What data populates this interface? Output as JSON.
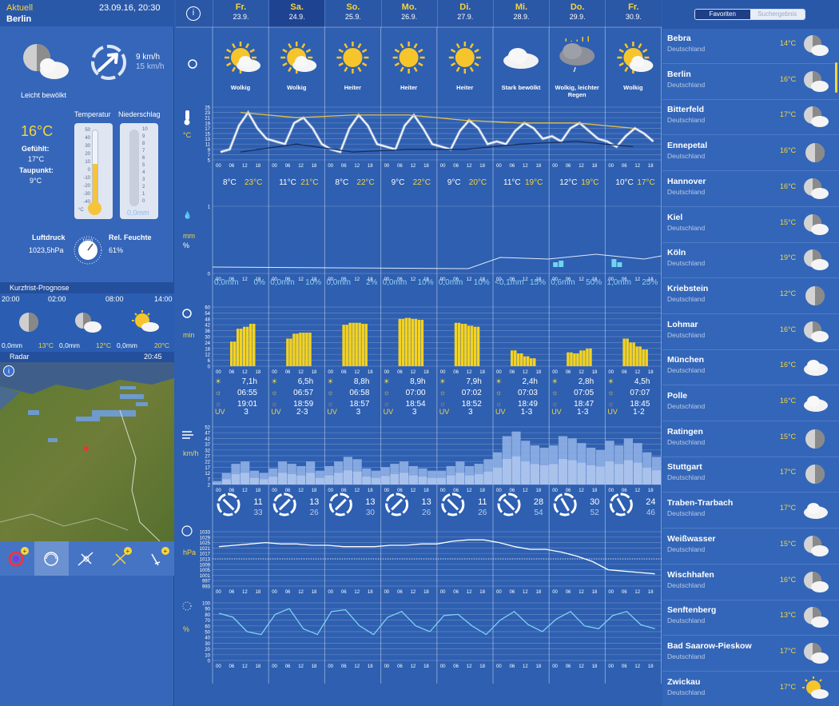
{
  "current": {
    "label": "Aktuell",
    "datetime": "23.09.16, 20:30",
    "city": "Berlin",
    "condition": "Leicht bewölkt",
    "wind_speed_kmh": "9 km/h",
    "wind_gust_kmh": "15 km/h",
    "temp_label": "Temperatur",
    "precip_label": "Niederschlag",
    "temperature": "16°C",
    "feels_label": "Gefühlt:",
    "feels": "17°C",
    "dew_label": "Taupunkt:",
    "dew": "9°C",
    "precip": "0,0mm",
    "pressure_label": "Luftdruck",
    "pressure": "1023,5hPa",
    "humidity_label": "Rel. Feuchte",
    "humidity": "61%",
    "thermo_scale": [
      "50",
      "40",
      "30",
      "20",
      "10",
      "0",
      "-10",
      "-20",
      "-30",
      "-40"
    ],
    "thermo_unit": "°C",
    "precip_scale": [
      "10",
      "9",
      "8",
      "7",
      "6",
      "5",
      "4",
      "3",
      "2",
      "1",
      "0"
    ],
    "baro_value": "1010",
    "thermo_level": 0.56
  },
  "short_forecast": {
    "title": "Kurzfrist-Prognose",
    "times": [
      "20:00",
      "02:00",
      "08:00",
      "14:00"
    ],
    "precip": [
      "0,0mm",
      "0,0mm",
      "0,0mm"
    ],
    "temps": [
      "13°C",
      "12°C",
      "20°C"
    ]
  },
  "radar": {
    "label": "Radar",
    "time": "20:45"
  },
  "days": [
    {
      "name": "Fr.",
      "date": "23.9.",
      "cond": "Wolkig",
      "icon": "sun-cloud-icon",
      "tmin": "8°C",
      "tmax": "23°C",
      "rain": "0,0mm",
      "rainp": "0%",
      "sun": "7,1h",
      "rise": "06:55",
      "set": "19:01",
      "uv": "3",
      "wind": "11",
      "gust": "33",
      "dir": 45
    },
    {
      "name": "Sa.",
      "date": "24.9.",
      "cond": "Wolkig",
      "icon": "sun-cloud-icon",
      "tmin": "11°C",
      "tmax": "21°C",
      "rain": "0,0mm",
      "rainp": "10%",
      "sun": "6,5h",
      "rise": "06:57",
      "set": "18:59",
      "uv": "2-3",
      "wind": "13",
      "gust": "26",
      "dir": 135
    },
    {
      "name": "So.",
      "date": "25.9.",
      "cond": "Heiter",
      "icon": "sun-icon",
      "tmin": "8°C",
      "tmax": "22°C",
      "rain": "0,0mm",
      "rainp": "2%",
      "sun": "8,8h",
      "rise": "06:58",
      "set": "18:57",
      "uv": "3",
      "wind": "13",
      "gust": "30",
      "dir": 135
    },
    {
      "name": "Mo.",
      "date": "26.9.",
      "cond": "Heiter",
      "icon": "sun-icon",
      "tmin": "9°C",
      "tmax": "22°C",
      "rain": "0,0mm",
      "rainp": "10%",
      "sun": "8,9h",
      "rise": "07:00",
      "set": "18:54",
      "uv": "3",
      "wind": "13",
      "gust": "26",
      "dir": 135
    },
    {
      "name": "Di.",
      "date": "27.9.",
      "cond": "Heiter",
      "icon": "sun-icon",
      "tmin": "9°C",
      "tmax": "20°C",
      "rain": "0,0mm",
      "rainp": "10%",
      "sun": "7,9h",
      "rise": "07:02",
      "set": "18:52",
      "uv": "3",
      "wind": "11",
      "gust": "26",
      "dir": 225
    },
    {
      "name": "Mi.",
      "date": "28.9.",
      "cond": "Stark bewölkt",
      "icon": "cloud-icon",
      "tmin": "11°C",
      "tmax": "19°C",
      "rain": "<0,1mm",
      "rainp": "15%",
      "sun": "2,4h",
      "rise": "07:03",
      "set": "18:49",
      "uv": "1-3",
      "wind": "28",
      "gust": "54",
      "dir": 225
    },
    {
      "name": "Do.",
      "date": "29.9.",
      "cond": "Wolkig, leichter Regen",
      "icon": "cloud-rain-icon",
      "tmin": "12°C",
      "tmax": "19°C",
      "rain": "0,6mm",
      "rainp": "50%",
      "sun": "2,8h",
      "rise": "07:05",
      "set": "18:47",
      "uv": "1-3",
      "wind": "30",
      "gust": "52",
      "dir": 240
    },
    {
      "name": "Fr.",
      "date": "30.9.",
      "cond": "Wolkig",
      "icon": "sun-cloud-icon",
      "tmin": "10°C",
      "tmax": "17°C",
      "rain": "1,0mm",
      "rainp": "25%",
      "sun": "4,5h",
      "rise": "07:07",
      "set": "18:45",
      "uv": "1-2",
      "wind": "24",
      "gust": "46",
      "dir": 240
    }
  ],
  "hours": [
    "00",
    "06",
    "12",
    "18"
  ],
  "units": {
    "temp": "°C",
    "rain": "mm",
    "rainp": "%",
    "sun": "min",
    "wind": "km/h",
    "pressure": "hPa",
    "humidity": "%"
  },
  "uv_label": "UV",
  "temp_axis": [
    "25",
    "23",
    "21",
    "19",
    "17",
    "15",
    "13",
    "11",
    "9",
    "7",
    "5"
  ],
  "rain_axis": [
    "1",
    "0"
  ],
  "sun_axis": [
    "60",
    "54",
    "48",
    "42",
    "36",
    "30",
    "24",
    "18",
    "12",
    "6",
    "0"
  ],
  "wind_axis": [
    "52",
    "47",
    "42",
    "37",
    "32",
    "27",
    "22",
    "17",
    "12",
    "7",
    "2"
  ],
  "pressure_axis": [
    "1033",
    "1029",
    "1025",
    "1021",
    "1017",
    "1013",
    "1009",
    "1005",
    "1001",
    "997",
    "993"
  ],
  "humidity_axis": [
    "100",
    "90",
    "80",
    "70",
    "60",
    "50",
    "40",
    "30",
    "20",
    "10",
    "0"
  ],
  "chart_data": {
    "type": "line",
    "title": "",
    "series": [
      {
        "temp_hourly": [
          8,
          9,
          18,
          23,
          17,
          13,
          12,
          11,
          19,
          21,
          17,
          11,
          9,
          8,
          17,
          22,
          18,
          11,
          10,
          9,
          18,
          22,
          17,
          11,
          10,
          9,
          16,
          20,
          17,
          11,
          12,
          11,
          16,
          19,
          17,
          13,
          14,
          12,
          17,
          19,
          16,
          13,
          12,
          10,
          14,
          17,
          15,
          12
        ]
      },
      {
        "sun_hourly": [
          0,
          0,
          0,
          0,
          0,
          0,
          0,
          0,
          0,
          0,
          0,
          0,
          0,
          0,
          0,
          0,
          0,
          0,
          0,
          0,
          0,
          0,
          0,
          0,
          0,
          0,
          0,
          0,
          0,
          0,
          0,
          0,
          0,
          0,
          0,
          0,
          0,
          0,
          0,
          0,
          0,
          0,
          0,
          0,
          0,
          0,
          0,
          0
        ]
      }
    ],
    "sun_per_day": [
      [
        25,
        38,
        40,
        43,
        0
      ],
      [
        28,
        33,
        34,
        34,
        0
      ],
      [
        42,
        44,
        44,
        43,
        0
      ],
      [
        48,
        49,
        48,
        47,
        0
      ],
      [
        44,
        43,
        41,
        40,
        0
      ],
      [
        16,
        13,
        10,
        8,
        0
      ],
      [
        14,
        13,
        16,
        18,
        0
      ],
      [
        28,
        24,
        20,
        17,
        0
      ]
    ],
    "wind_per_day": [
      [
        5,
        12,
        20,
        22,
        14,
        12
      ],
      [
        16,
        22,
        20,
        18,
        22,
        14
      ],
      [
        18,
        22,
        26,
        24,
        16,
        14
      ],
      [
        17,
        20,
        22,
        18,
        16,
        14
      ],
      [
        14,
        18,
        22,
        18,
        20,
        24
      ],
      [
        30,
        44,
        48,
        40,
        36,
        34
      ],
      [
        36,
        44,
        42,
        38,
        34,
        32
      ],
      [
        40,
        36,
        42,
        38,
        30,
        26
      ]
    ],
    "pressure_series": [
      1022,
      1023,
      1024,
      1025,
      1024,
      1024,
      1023,
      1023,
      1022,
      1022,
      1022,
      1023,
      1023,
      1024,
      1024,
      1026,
      1027,
      1027,
      1025,
      1022,
      1020,
      1020,
      1018,
      1015,
      1011,
      1005,
      1004,
      1003,
      1002
    ],
    "humidity_series": [
      82,
      75,
      50,
      45,
      80,
      90,
      55,
      45,
      85,
      88,
      60,
      45,
      75,
      85,
      60,
      50,
      78,
      80,
      60,
      45,
      70,
      85,
      62,
      50,
      72,
      85,
      60,
      55,
      78,
      85,
      62,
      55
    ],
    "ylim_temp": [
      5,
      25
    ],
    "ylim_pressure": [
      993,
      1033
    ]
  },
  "favorites": {
    "tab_favorites": "Favoriten",
    "tab_results": "Suchergebnis"
  },
  "cities": [
    {
      "name": "Bebra",
      "country": "Deutschland",
      "temp": "14°C",
      "icon": "moon-cloud-icon"
    },
    {
      "name": "Berlin",
      "country": "Deutschland",
      "temp": "16°C",
      "icon": "moon-cloud-icon"
    },
    {
      "name": "Bitterfeld",
      "country": "Deutschland",
      "temp": "17°C",
      "icon": "moon-cloud-icon"
    },
    {
      "name": "Ennepetal",
      "country": "Deutschland",
      "temp": "16°C",
      "icon": "moon-icon"
    },
    {
      "name": "Hannover",
      "country": "Deutschland",
      "temp": "16°C",
      "icon": "moon-cloud-icon"
    },
    {
      "name": "Kiel",
      "country": "Deutschland",
      "temp": "15°C",
      "icon": "moon-cloud-icon"
    },
    {
      "name": "Köln",
      "country": "Deutschland",
      "temp": "19°C",
      "icon": "moon-cloud-icon"
    },
    {
      "name": "Kriebstein",
      "country": "Deutschland",
      "temp": "12°C",
      "icon": "moon-icon"
    },
    {
      "name": "Lohmar",
      "country": "Deutschland",
      "temp": "16°C",
      "icon": "moon-cloud-icon"
    },
    {
      "name": "München",
      "country": "Deutschland",
      "temp": "16°C",
      "icon": "cloud-icon"
    },
    {
      "name": "Polle",
      "country": "Deutschland",
      "temp": "16°C",
      "icon": "cloud-icon"
    },
    {
      "name": "Ratingen",
      "country": "Deutschland",
      "temp": "15°C",
      "icon": "moon-icon"
    },
    {
      "name": "Stuttgart",
      "country": "Deutschland",
      "temp": "17°C",
      "icon": "moon-icon"
    },
    {
      "name": "Traben-Trarbach",
      "country": "Deutschland",
      "temp": "17°C",
      "icon": "cloud-icon"
    },
    {
      "name": "Weißwasser",
      "country": "Deutschland",
      "temp": "15°C",
      "icon": "moon-cloud-icon"
    },
    {
      "name": "Wischhafen",
      "country": "Deutschland",
      "temp": "16°C",
      "icon": "moon-cloud-icon"
    },
    {
      "name": "Senftenberg",
      "country": "Deutschland",
      "temp": "13°C",
      "icon": "moon-cloud-icon"
    },
    {
      "name": "Bad Saarow-Pieskow",
      "country": "Deutschland",
      "temp": "17°C",
      "icon": "moon-cloud-icon"
    },
    {
      "name": "Zwickau",
      "country": "Deutschland",
      "temp": "17°C",
      "icon": "sun-cloud-icon"
    }
  ]
}
